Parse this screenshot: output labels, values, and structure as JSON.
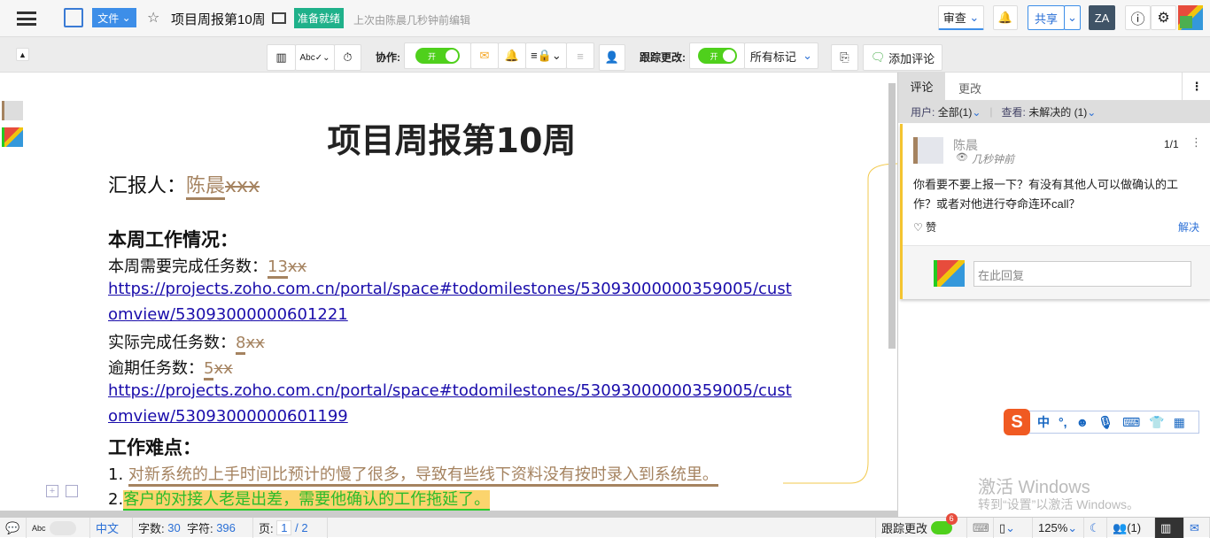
{
  "header": {
    "file_menu": "文件",
    "doc_title": "项目周报第10周",
    "status_badge": "准备就绪",
    "last_edit": "上次由陈晨几秒钟前编辑",
    "review_menu": "审查",
    "share_button": "共享"
  },
  "toolbar": {
    "collab_label": "协作:",
    "collab_toggle": "开",
    "track_label": "跟踪更改:",
    "track_toggle": "开",
    "markup_select": "所有标记",
    "add_comment": "添加评论"
  },
  "document": {
    "title": "项目周报第10周",
    "reporter_label": "汇报人：",
    "reporter_ins": "陈晨",
    "reporter_del": "xxx",
    "section1": "本周工作情况：",
    "tasks_label": "本周需要完成任务数：",
    "tasks_ins": "13",
    "tasks_del": "xx",
    "link1a": "https://projects.zoho.com.cn/portal/space#todomilestones/53093000000359005/cust",
    "link1b": "omview/53093000000601221",
    "done_label": "实际完成任务数：",
    "done_ins": "8",
    "done_del": "xx",
    "overdue_label": "逾期任务数：",
    "overdue_ins": "5",
    "overdue_del": "xx",
    "link2a": "https://projects.zoho.com.cn/portal/space#todomilestones/53093000000359005/cust",
    "link2b": "omview/53093000000601199",
    "section2": "工作难点：",
    "item1_num": "1. ",
    "item1": "对新系统的上手时间比预计的慢了很多，导致有些线下资料没有按时录入到系统里。",
    "item2_num": "2.",
    "item2": "客户的对接人老是出差，需要他确认的工作拖延了。"
  },
  "sidebar": {
    "tab_comments": "评论",
    "tab_changes": "更改",
    "user_label": "用户:",
    "user_value": "全部(1)",
    "view_label": "查看:",
    "view_value": "未解决的 (1)",
    "comment": {
      "author": "陈晨",
      "time": "几秒钟前",
      "count": "1/1",
      "text": "你看要不要上报一下？有没有其他人可以做确认的工作？或者对他进行夺命连环call？",
      "like": "赞",
      "resolve": "解决",
      "reply_placeholder": "在此回复"
    }
  },
  "ime": {
    "lang": "中",
    "punct": "°,"
  },
  "watermark": {
    "line1": "激活 Windows",
    "line2": "转到“设置”以激活 Windows。"
  },
  "status": {
    "language": "中文",
    "words_label": "字数:",
    "words": "30",
    "chars_label": "字符:",
    "chars": "396",
    "page_label": "页:",
    "page": "1",
    "pages": "/ 2",
    "track_label": "跟踪更改",
    "track_badge": "6",
    "zoom": "125%",
    "users": "(1)"
  }
}
